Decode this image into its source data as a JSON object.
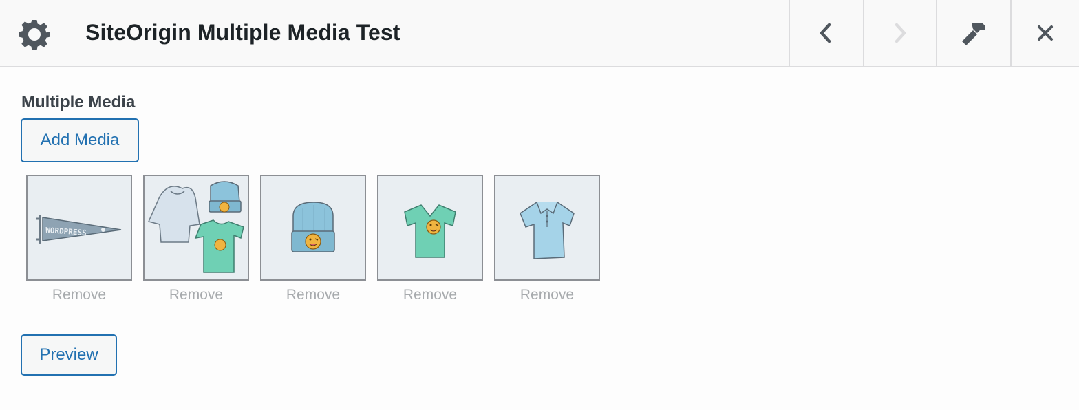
{
  "dialog": {
    "title": "SiteOrigin Multiple Media Test",
    "icons": {
      "settings": "gear-icon",
      "previous": "chevron-left-icon",
      "next": "chevron-right-icon",
      "tools": "hammer-icon",
      "close": "close-icon"
    },
    "next_disabled": true
  },
  "field": {
    "label": "Multiple Media",
    "add_button": "Add Media",
    "preview_button": "Preview",
    "media": [
      {
        "image": "wordpress-pennant",
        "remove_label": "Remove"
      },
      {
        "image": "hoodie-beanie-tshirt-set",
        "remove_label": "Remove"
      },
      {
        "image": "beanie",
        "remove_label": "Remove"
      },
      {
        "image": "green-t-shirt",
        "remove_label": "Remove"
      },
      {
        "image": "blue-polo-shirt",
        "remove_label": "Remove"
      }
    ]
  },
  "colors": {
    "accent": "#2271b1",
    "title_text": "#1d2327",
    "muted_text": "#a7aaad",
    "thumb_border": "#8c8f94"
  }
}
